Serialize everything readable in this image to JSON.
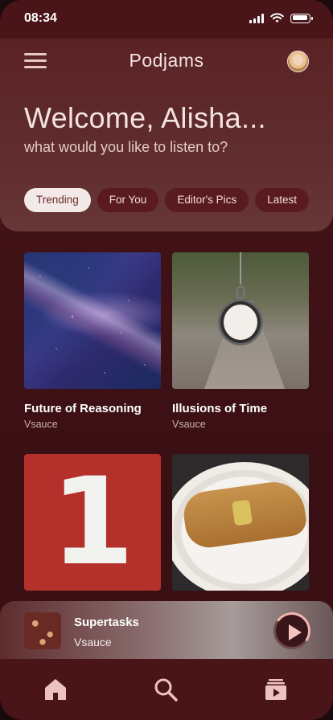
{
  "status_bar": {
    "time": "08:34"
  },
  "header": {
    "app_title": "Podjams"
  },
  "welcome": {
    "greeting": "Welcome, Alisha...",
    "subtitle": "what would you like to listen to?"
  },
  "categories": [
    {
      "label": "Trending",
      "active": true
    },
    {
      "label": "For You",
      "active": false
    },
    {
      "label": "Editor's Pics",
      "active": false
    },
    {
      "label": "Latest",
      "active": false
    }
  ],
  "podcasts": [
    {
      "title": "Future of Reasoning",
      "author": "Vsauce",
      "image": "milky-way"
    },
    {
      "title": "Illusions of Time",
      "author": "Vsauce",
      "image": "pocket-watch"
    },
    {
      "title": "",
      "author": "",
      "image": "number-one"
    },
    {
      "title": "",
      "author": "",
      "image": "dinner-plate"
    }
  ],
  "now_playing": {
    "title": "Supertasks",
    "author": "Vsauce",
    "progress": 0.3
  },
  "tabbar": {
    "items": [
      "home-icon",
      "search-icon",
      "library-icon"
    ]
  },
  "colors": {
    "background": "#3e1216",
    "chip_active": "#f3e9e8",
    "chip": "#5a1b1e",
    "accent": "#f2b6b0"
  }
}
